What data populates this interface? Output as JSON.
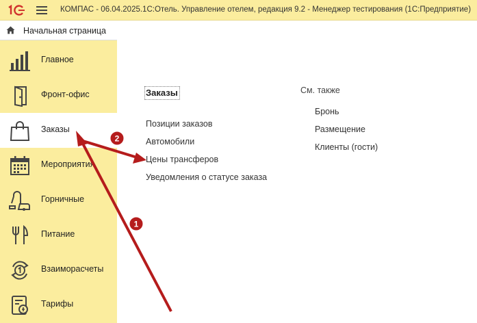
{
  "window": {
    "title": "КОМПАС - 06.04.2025.1С:Отель. Управление отелем, редакция 9.2  - Менеджер тестирования (1С:Предприятие)",
    "logo_text": "1С"
  },
  "sidebar": {
    "home_label": "Начальная страница",
    "items": [
      {
        "label": "Главное",
        "icon": "bar-chart-icon"
      },
      {
        "label": "Фронт-офис",
        "icon": "door-icon"
      },
      {
        "label": "Заказы",
        "icon": "shopping-bag-icon",
        "active": true
      },
      {
        "label": "Мероприятия",
        "icon": "calendar-icon"
      },
      {
        "label": "Горничные",
        "icon": "vacuum-icon"
      },
      {
        "label": "Питание",
        "icon": "cutlery-icon"
      },
      {
        "label": "Взаиморасчеты",
        "icon": "exchange-icon"
      },
      {
        "label": "Тарифы",
        "icon": "tariff-icon"
      }
    ]
  },
  "main": {
    "section_title": "Заказы",
    "links": [
      "Позиции заказов",
      "Автомобили",
      "Цены трансферов",
      "Уведомления о статусе заказа"
    ],
    "see_also": {
      "title": "См. также",
      "links": [
        "Бронь",
        "Размещение",
        "Клиенты (гости)"
      ]
    }
  },
  "annotations": {
    "badge_1": "1",
    "badge_2": "2",
    "color": "#b51c1c"
  }
}
